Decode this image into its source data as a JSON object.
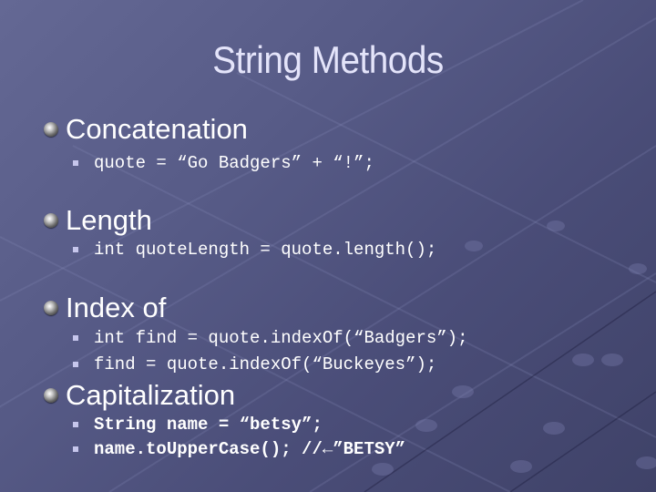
{
  "slide": {
    "title": "String Methods",
    "sections": [
      {
        "heading": "Concatenation",
        "bullets": [
          "quote = “Go Badgers” + “!”;"
        ]
      },
      {
        "heading": "Length",
        "bullets": [
          "int quoteLength = quote.length();"
        ]
      },
      {
        "heading": "Index of",
        "bullets": [
          "int find = quote.indexOf(“Badgers”);",
          "find = quote.indexOf(“Buckeyes”);"
        ]
      },
      {
        "heading": "Capitalization",
        "bullets": [
          "String name = “betsy”;",
          "name.toUpperCase(); //←”BETSY”"
        ]
      }
    ]
  },
  "colors": {
    "background": "#575b87",
    "title": "#e4e4fa",
    "text": "#ffffff",
    "square_bullet": "#c6c6ec"
  }
}
